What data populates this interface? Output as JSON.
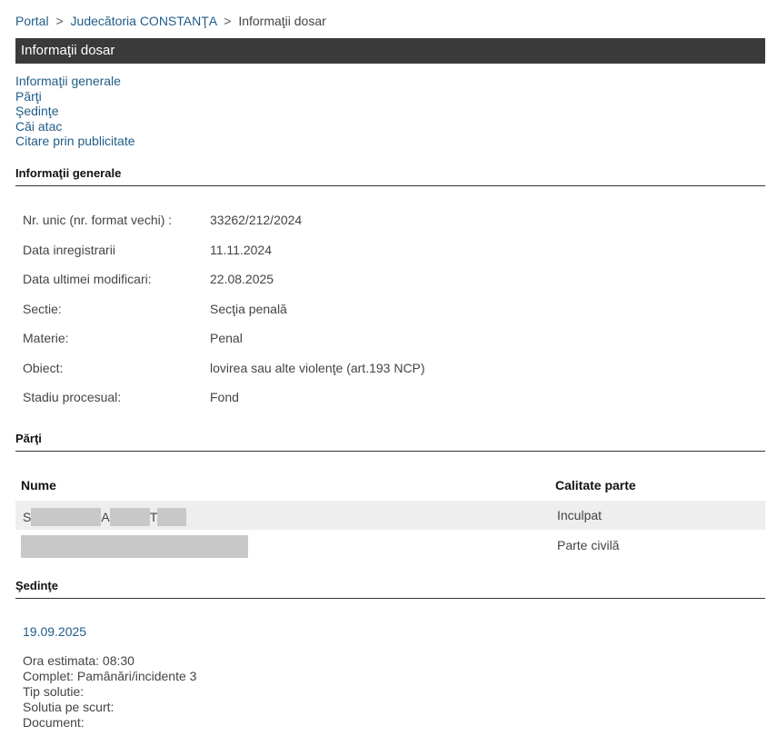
{
  "breadcrumb": {
    "portal": "Portal",
    "court": "Judecătoria CONSTANŢA",
    "current": "Informaţii dosar",
    "separator": ">"
  },
  "title": "Informaţii dosar",
  "nav_links": [
    "Informaţii generale",
    "Părţi",
    "Şedinţe",
    "Căi atac",
    "Citare prin publicitate"
  ],
  "sections": {
    "general": "Informaţii generale",
    "parti": "Părţi",
    "sedinte": "Şedinţe"
  },
  "general_info": [
    {
      "label": "Nr. unic (nr. format vechi) :",
      "value": "33262/212/2024"
    },
    {
      "label": "Data inregistrarii",
      "value": "11.11.2024"
    },
    {
      "label": "Data ultimei modificari:",
      "value": "22.08.2025"
    },
    {
      "label": "Sectie:",
      "value": "Secţia penală"
    },
    {
      "label": "Materie:",
      "value": "Penal"
    },
    {
      "label": "Obiect:",
      "value": "lovirea sau alte violenţe (art.193 NCP)"
    },
    {
      "label": "Stadiu procesual:",
      "value": "Fond"
    }
  ],
  "parti": {
    "headers": {
      "nume": "Nume",
      "calitate": "Calitate parte"
    },
    "rows": [
      {
        "name_initials": [
          "S",
          "A",
          "T"
        ],
        "calitate": "Inculpat"
      },
      {
        "name_initials": [],
        "calitate": "Parte civilă"
      }
    ]
  },
  "sedinte": {
    "date": "19.09.2025",
    "details": [
      "Ora estimata: 08:30",
      "Complet: Pamânări/incidente 3",
      "Tip solutie:",
      "Solutia pe scurt:",
      "Document:"
    ]
  }
}
